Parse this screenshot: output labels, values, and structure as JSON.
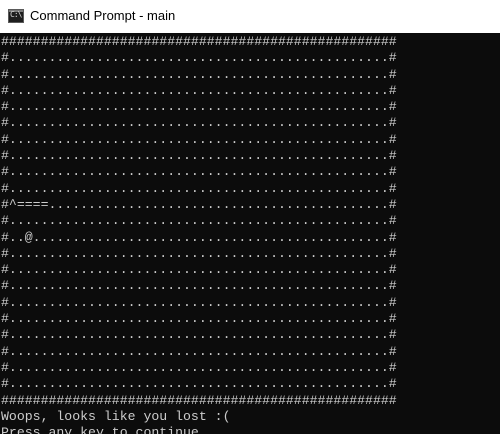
{
  "window": {
    "title": "Command Prompt - main",
    "icon": "command-prompt-icon",
    "icon_glyph": "C:\\"
  },
  "colors": {
    "console_background": "#0c0c0c",
    "console_text": "#cccccc",
    "titlebar_background": "#ffffff",
    "title_text": "#000000"
  },
  "console": {
    "lines": [
      "##################################################",
      "#................................................#",
      "#................................................#",
      "#................................................#",
      "#................................................#",
      "#................................................#",
      "#................................................#",
      "#................................................#",
      "#................................................#",
      "#................................................#",
      "#^====...........................................#",
      "#................................................#",
      "#..@.............................................#",
      "#................................................#",
      "#................................................#",
      "#................................................#",
      "#................................................#",
      "#................................................#",
      "#................................................#",
      "#................................................#",
      "#................................................#",
      "#................................................#",
      "##################################################",
      "Woops, looks like you lost :(",
      "Press any key to continue . . ."
    ]
  }
}
